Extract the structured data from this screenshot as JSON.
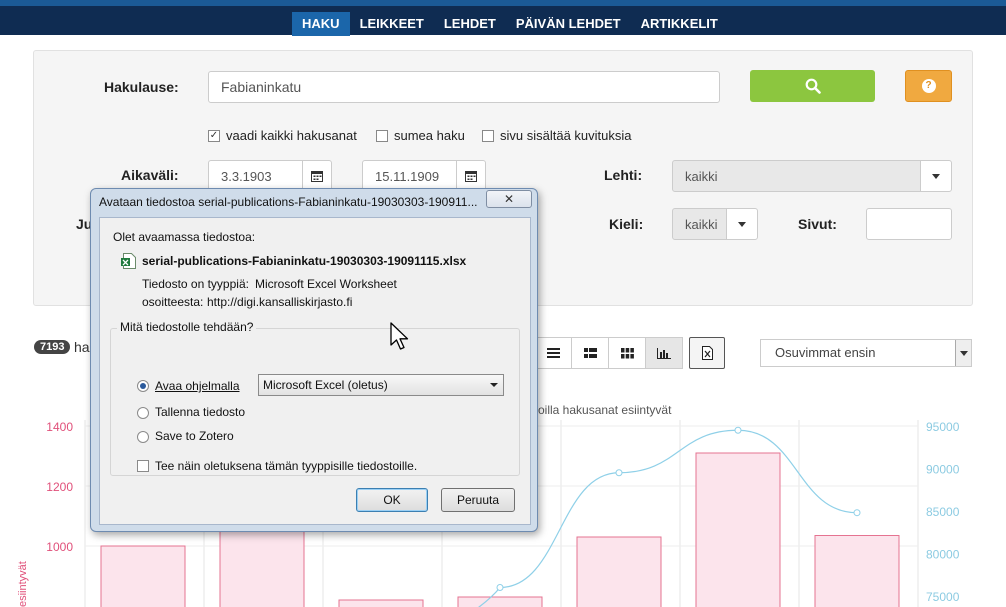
{
  "nav": {
    "items": [
      {
        "label": "HAKU",
        "active": true
      },
      {
        "label": "LEIKKEET"
      },
      {
        "label": "LEHDET"
      },
      {
        "label": "PÄIVÄN LEHDET"
      },
      {
        "label": "ARTIKKELIT"
      }
    ]
  },
  "search": {
    "query_label": "Hakulause:",
    "query_value": "Fabianinkatu",
    "search_icon": "search-icon",
    "help_icon": "question-icon",
    "help_glyph": "?",
    "options": [
      {
        "label": "vaadi kaikki hakusanat",
        "checked": true
      },
      {
        "label": "sumea haku",
        "checked": false
      },
      {
        "label": "sivu sisältää kuvituksia",
        "checked": false
      }
    ],
    "period_label": "Aikaväli:",
    "date_from": "3.3.1903",
    "date_to": "15.11.1909",
    "paper_label": "Lehti:",
    "paper_value": "kaikki",
    "hidden_label_fragment": "Ju",
    "language_label": "Kieli:",
    "language_value": "kaikki",
    "pages_label": "Sivut:",
    "pages_value": ""
  },
  "results": {
    "count": "7193",
    "text_fragment": "ha",
    "sort_value": "Osuvimmat ensin"
  },
  "chart_data": {
    "type": "bar",
    "title_fragment": "oilla hakusanat esiintyvät",
    "ylabel_fragment": "esiintyvät",
    "y_left_ticks": [
      1400,
      1200,
      1000
    ],
    "y_right_ticks": [
      95000,
      90000,
      85000,
      80000,
      75000
    ],
    "series": [
      {
        "name": "",
        "type": "bar",
        "values": [
          1000,
          1160,
          820,
          830,
          1030,
          1310,
          1035
        ]
      },
      {
        "name": "",
        "type": "line",
        "values": [
          null,
          null,
          null,
          76000,
          89500,
          94500,
          84800
        ]
      }
    ],
    "colors": {
      "bar_fill": "#fce4ec",
      "bar_stroke": "#e57391",
      "line": "#8fd0e8",
      "left_axis": "#e0507a",
      "right_axis": "#8ccbe2"
    }
  },
  "dialog": {
    "title": "Avataan tiedostoa serial-publications-Fabianinkatu-19030303-190911...",
    "close_glyph": "✕",
    "opening_text": "Olet avaamassa tiedostoa:",
    "file_name": "serial-publications-Fabianinkatu-19030303-19091115.xlsx",
    "type_label": "Tiedosto on tyyppiä:",
    "type_value": "Microsoft Excel Worksheet",
    "from_label": "osoitteesta:",
    "from_value": "http://digi.kansalliskirjasto.fi",
    "question": "Mitä tiedostolle tehdään?",
    "open_with_label": "Avaa ohjelmalla",
    "open_with_value": "Microsoft Excel (oletus)",
    "save_label": "Tallenna tiedosto",
    "zotero_label": "Save to Zotero",
    "default_label": "Tee näin oletuksena tämän tyyppisille tiedostoille.",
    "ok_label": "OK",
    "cancel_label": "Peruuta"
  }
}
